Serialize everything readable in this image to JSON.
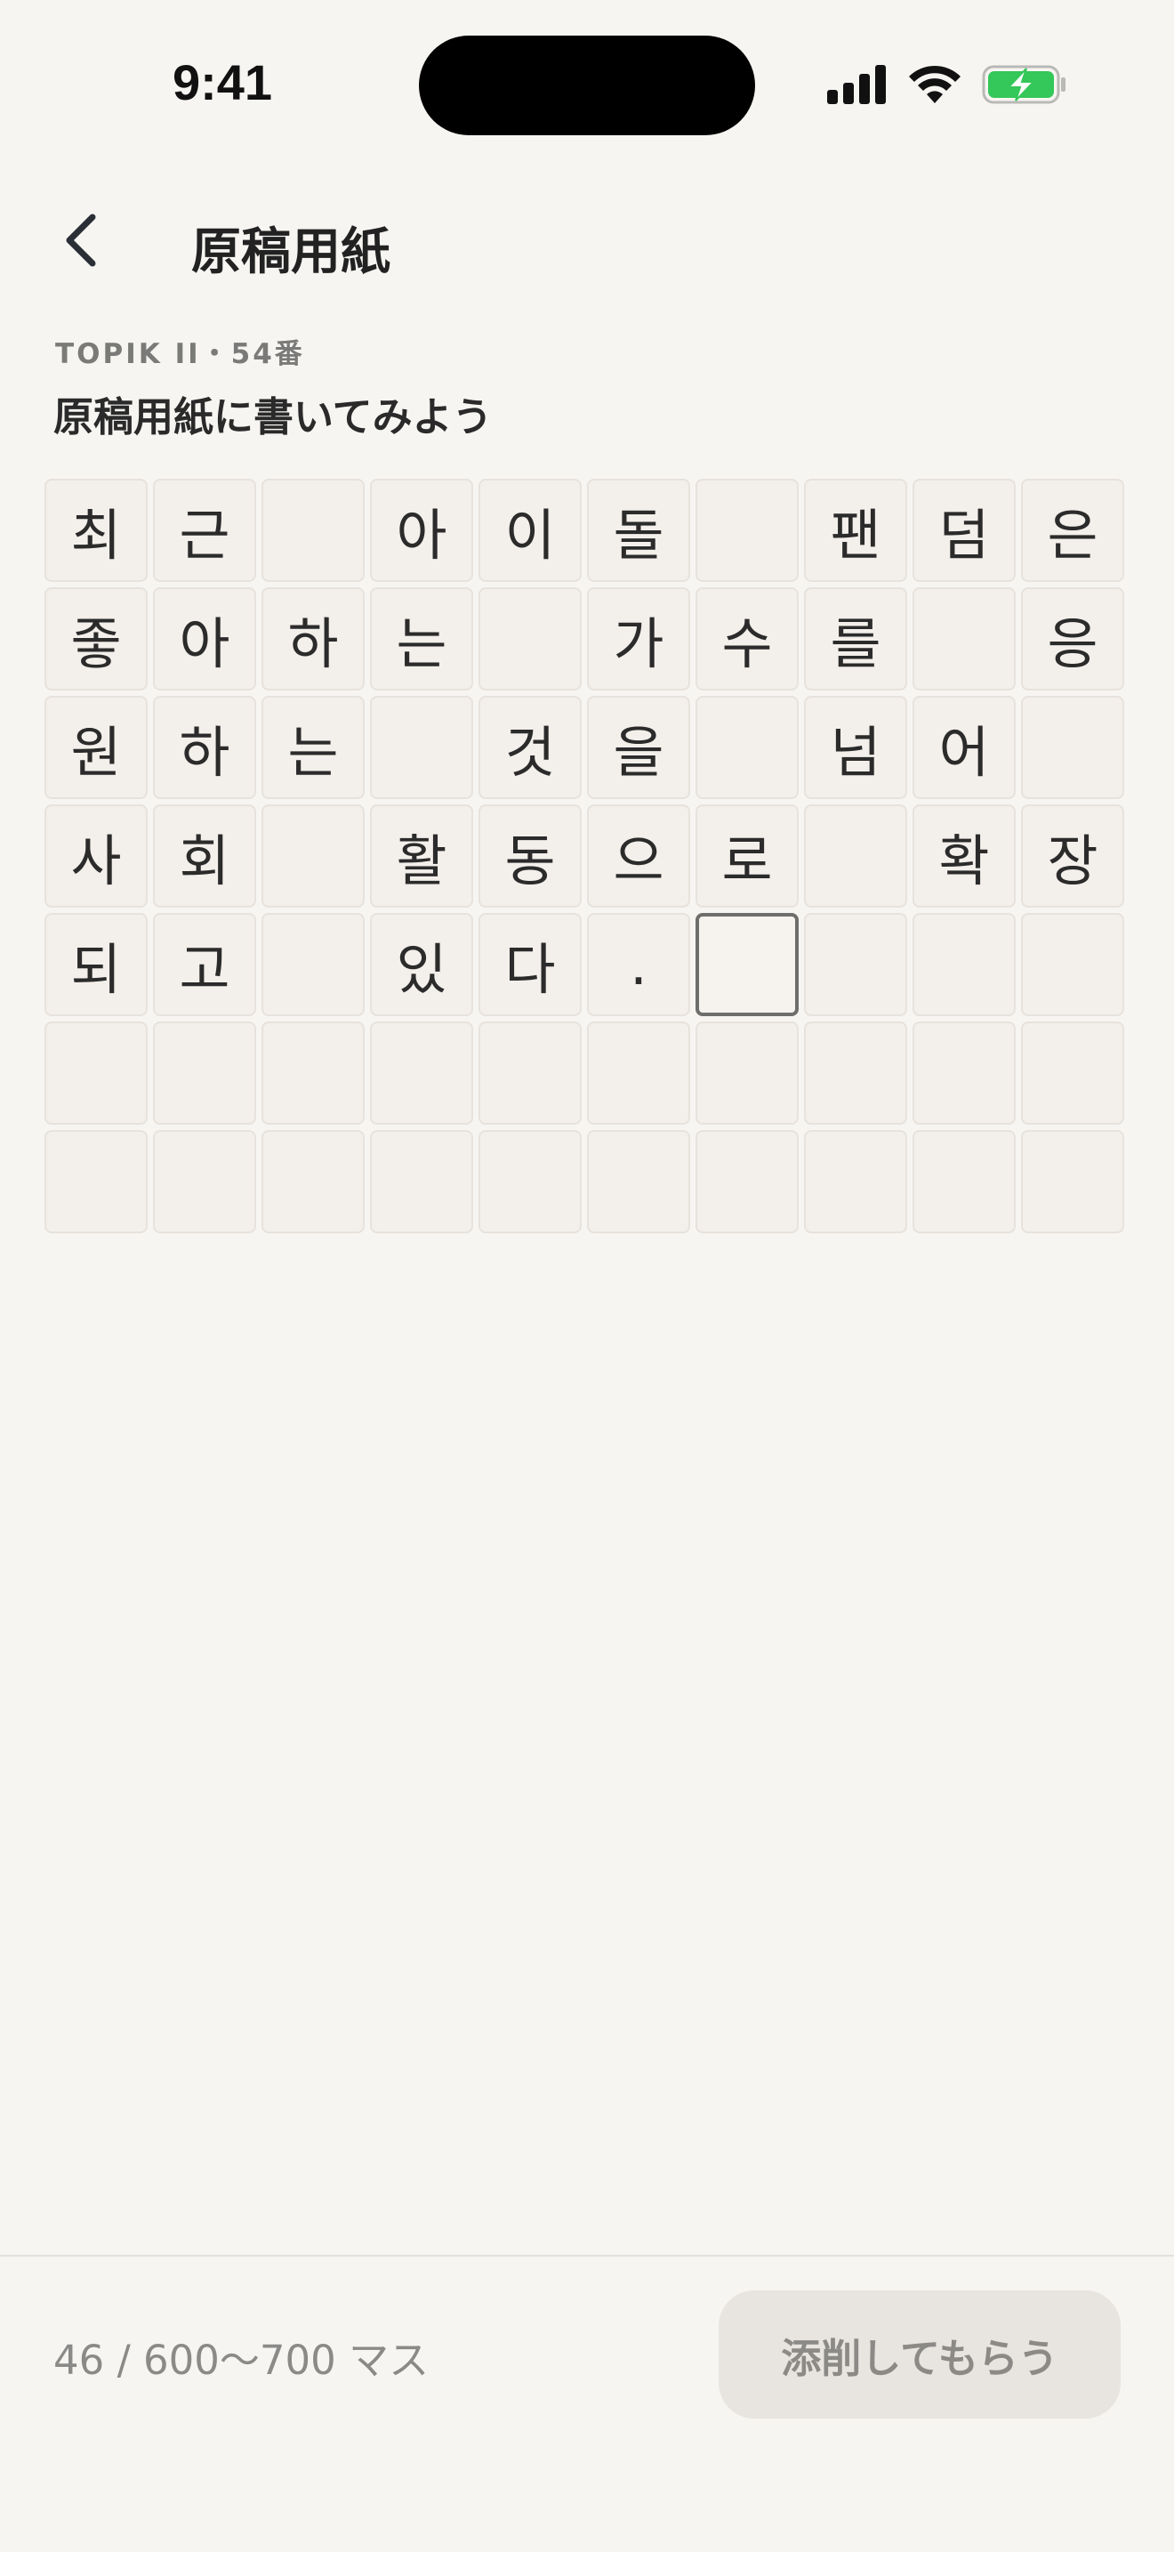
{
  "status_bar": {
    "time": "9:41"
  },
  "nav": {
    "title": "原稿用紙"
  },
  "header": {
    "subtitle": "TOPIK II・54番",
    "heading": "原稿用紙に書いてみよう"
  },
  "grid": {
    "columns": 10,
    "rows": 7,
    "active_index": 46,
    "cells": [
      "최",
      "근",
      "",
      "아",
      "이",
      "돌",
      "",
      "팬",
      "덤",
      "은",
      "좋",
      "아",
      "하",
      "는",
      "",
      "가",
      "수",
      "를",
      "",
      "응",
      "원",
      "하",
      "는",
      "",
      "것",
      "을",
      "",
      "넘",
      "어",
      "",
      "사",
      "회",
      "",
      "활",
      "동",
      "으",
      "로",
      "",
      "확",
      "장",
      "되",
      "고",
      "",
      "있",
      "다",
      ".",
      "",
      "",
      "",
      "",
      "",
      "",
      "",
      "",
      "",
      "",
      "",
      "",
      "",
      "",
      "",
      "",
      "",
      "",
      "",
      "",
      "",
      "",
      "",
      ""
    ]
  },
  "footer": {
    "counter": "46 / 600〜700 マス",
    "submit_label": "添削してもらう"
  },
  "colors": {
    "background": "#f7f5f2",
    "cell_background": "#f3efea",
    "cell_border": "#e7e2dc",
    "active_border": "#6e6e6c",
    "battery_green": "#34c759"
  },
  "icons": [
    "back-chevron-icon",
    "signal-icon",
    "wifi-icon",
    "battery-charging-icon"
  ]
}
